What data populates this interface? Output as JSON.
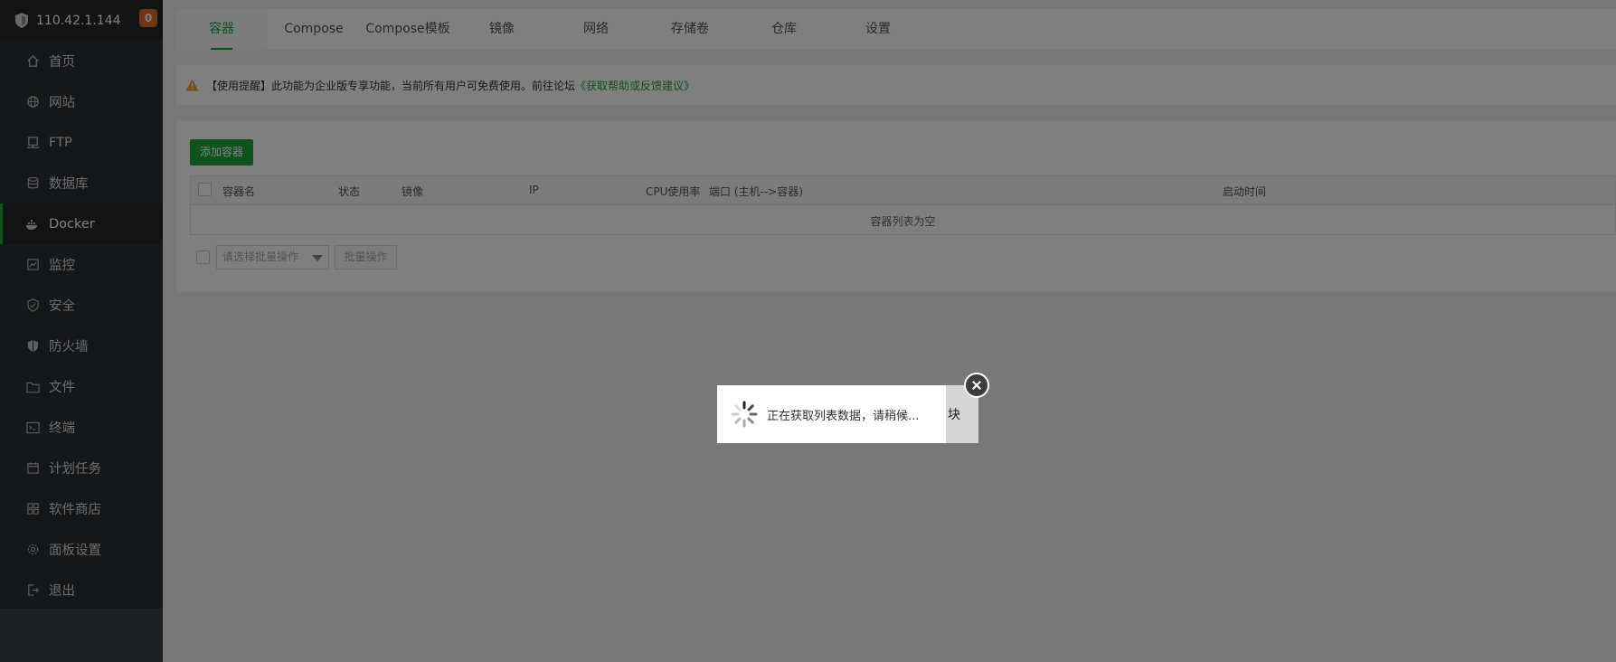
{
  "sidebar": {
    "server_ip": "110.42.1.144",
    "badge_count": "0",
    "items": [
      {
        "label": "首页",
        "icon": "home-icon"
      },
      {
        "label": "网站",
        "icon": "globe-icon"
      },
      {
        "label": "FTP",
        "icon": "ftp-icon"
      },
      {
        "label": "数据库",
        "icon": "database-icon"
      },
      {
        "label": "Docker",
        "icon": "docker-icon",
        "active": true
      },
      {
        "label": "监控",
        "icon": "monitor-icon"
      },
      {
        "label": "安全",
        "icon": "shield-check-icon"
      },
      {
        "label": "防火墙",
        "icon": "firewall-icon"
      },
      {
        "label": "文件",
        "icon": "folder-icon"
      },
      {
        "label": "终端",
        "icon": "terminal-icon"
      },
      {
        "label": "计划任务",
        "icon": "calendar-icon"
      },
      {
        "label": "软件商店",
        "icon": "apps-grid-icon"
      },
      {
        "label": "面板设置",
        "icon": "gear-icon"
      },
      {
        "label": "退出",
        "icon": "logout-icon"
      }
    ]
  },
  "tabs": [
    {
      "label": "容器",
      "active": true
    },
    {
      "label": "Compose"
    },
    {
      "label": "Compose模板"
    },
    {
      "label": "镜像"
    },
    {
      "label": "网络"
    },
    {
      "label": "存储卷"
    },
    {
      "label": "仓库"
    },
    {
      "label": "设置"
    }
  ],
  "notice": {
    "text": "【使用提醒】此功能为企业版专享功能，当前所有用户可免费使用。前往论坛",
    "link": "《获取帮助或反馈建议》"
  },
  "container_panel": {
    "add_button": "添加容器",
    "columns": [
      "容器名",
      "状态",
      "镜像",
      "IP",
      "CPU使用率",
      "端口 (主机-->容器)",
      "启动时间"
    ],
    "empty_text": "容器列表为空",
    "batch_placeholder": "请选择批量操作",
    "batch_button": "批量操作"
  },
  "modal": {
    "behind_text": "块",
    "loading_text": "正在获取列表数据，请稍候..."
  },
  "colors": {
    "accent": "#20a53a",
    "sidebar_bg": "#2b3136",
    "badge": "#e06a2b"
  }
}
